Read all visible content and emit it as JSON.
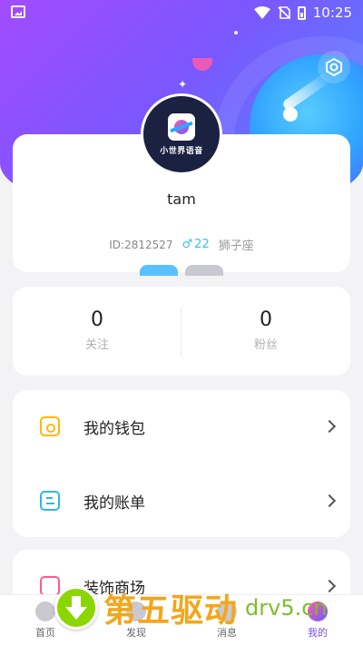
{
  "status_bar": {
    "time": "10:25",
    "icons": [
      "image-notification-icon",
      "wifi-icon",
      "no-sim-icon",
      "battery-charging-icon"
    ]
  },
  "profile": {
    "avatar_brand": "小世界语音",
    "nickname": "tam",
    "id_text": "ID:2812527",
    "gender_symbol": "♂",
    "age": "22",
    "constellation": "狮子座"
  },
  "stats": {
    "following_count": "0",
    "following_label": "关注",
    "fans_count": "0",
    "fans_label": "粉丝"
  },
  "menu": {
    "wallet_label": "我的钱包",
    "bill_label": "我的账单",
    "shop_label": "装饰商场"
  },
  "bottom_nav": {
    "items": [
      {
        "label": "首页",
        "icon": "planet-home-icon"
      },
      {
        "label": "发现",
        "icon": "discover-icon"
      },
      {
        "label": "消息",
        "icon": "message-icon"
      },
      {
        "label": "我的",
        "icon": "profile-planet-icon"
      }
    ],
    "active_index": 3
  },
  "watermark": {
    "text": "第五驱动",
    "site": "drv5.cn"
  },
  "colors": {
    "accent": "#7a4cff",
    "age_badge": "#36c3e6",
    "wallet": "#ffb800",
    "bill": "#2ab8e8",
    "shop": "#ff5a8a"
  }
}
